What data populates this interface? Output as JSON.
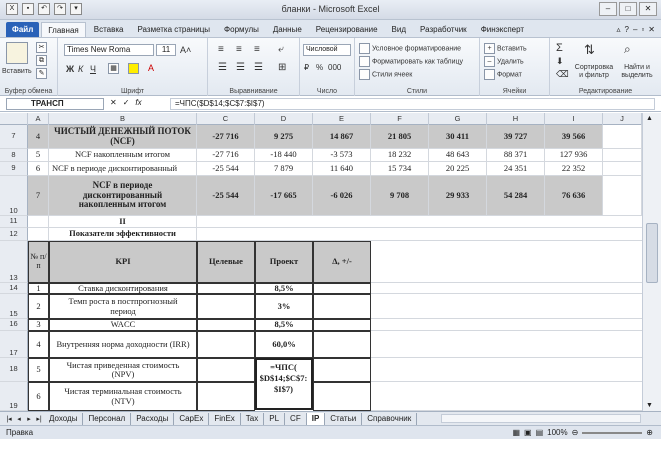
{
  "window": {
    "title": "бланки - Microsoft Excel"
  },
  "tabs": [
    "Файл",
    "Главная",
    "Вставка",
    "Разметка страницы",
    "Формулы",
    "Данные",
    "Рецензирование",
    "Вид",
    "Разработчик",
    "Финэксперт"
  ],
  "ribbon": {
    "paste": "Вставить",
    "clipboard": "Буфер обмена",
    "font_name": "Times New Roma",
    "font_size": "11",
    "font": "Шрифт",
    "alignment": "Выравнивание",
    "number_format": "Числовой",
    "number": "Число",
    "cond_format": "Условное форматирование",
    "table_format": "Форматировать как таблицу",
    "cell_styles": "Стили ячеек",
    "styles": "Стили",
    "insert": "Вставить",
    "delete": "Удалить",
    "format": "Формат",
    "cells": "Ячейки",
    "sort": "Сортировка и фильтр",
    "find": "Найти и выделить",
    "editing": "Редактирование"
  },
  "formula_bar": {
    "name_box": "ТРАНСП",
    "formula": "=ЧПС($D$14;$C$7:$I$7)"
  },
  "columns": [
    "A",
    "B",
    "C",
    "D",
    "E",
    "F",
    "G",
    "H",
    "I",
    "J"
  ],
  "rows": {
    "r7": {
      "num": "7",
      "a": "4",
      "b": "ЧИСТЫЙ ДЕНЕЖНЫЙ ПОТОК (NCF)",
      "vals": [
        "-27 716",
        "9 275",
        "14 867",
        "21 805",
        "30 411",
        "39 727",
        "39 566"
      ]
    },
    "r8": {
      "num": "8",
      "a": "5",
      "b": "NCF накопленным итогом",
      "vals": [
        "-27 716",
        "-18 440",
        "-3 573",
        "18 232",
        "48 643",
        "88 371",
        "127 936"
      ]
    },
    "r9": {
      "num": "9",
      "a": "6",
      "b": "NCF  в периоде дисконтированный",
      "vals": [
        "-25 544",
        "7 879",
        "11 640",
        "15 734",
        "20 225",
        "24 351",
        "22 352"
      ]
    },
    "r10": {
      "num": "10",
      "a": "7",
      "b": "NCF  в периоде дисконтированный накопленным итогом",
      "vals": [
        "-25 544",
        "-17 665",
        "-6 026",
        "9 708",
        "29 933",
        "54 284",
        "76 636"
      ]
    },
    "r11": {
      "num": "11",
      "b": "II"
    },
    "r12": {
      "num": "12",
      "b": "Показатели эффективности"
    },
    "r13": {
      "num": "13",
      "a": "№ п/п",
      "b": "KPI",
      "c": "Целевые",
      "d": "Проект",
      "e": "Δ, +/-"
    },
    "r14": {
      "num": "14",
      "a": "1",
      "b": "Ставка дисконтирования",
      "d": "8,5%"
    },
    "r15": {
      "num": "15",
      "a": "2",
      "b": "Темп роста в постпрогнозный период",
      "d": "3%"
    },
    "r16": {
      "num": "16",
      "a": "3",
      "b": "WACC",
      "d": "8,5%"
    },
    "r17": {
      "num": "17",
      "a": "4",
      "b": "Внутренняя норма доходности (IRR)",
      "d": "60,0%"
    },
    "r18": {
      "num": "18",
      "a": "5",
      "b": "Чистая приведенная стоимость (NPV)",
      "d": "=ЧПС( $D$14;$C$7: $I$7)"
    },
    "r19": {
      "num": "19",
      "a": "6",
      "b": "Чистая терминальная стоимость (NTV)"
    }
  },
  "sheets": [
    "Доходы",
    "Персонал",
    "Расходы",
    "CapEx",
    "FinEx",
    "Tax",
    "PL",
    "CF",
    "IP",
    "Статьи",
    "Справочник"
  ],
  "active_sheet": "IP",
  "status": {
    "mode": "Правка",
    "zoom": "100%"
  }
}
